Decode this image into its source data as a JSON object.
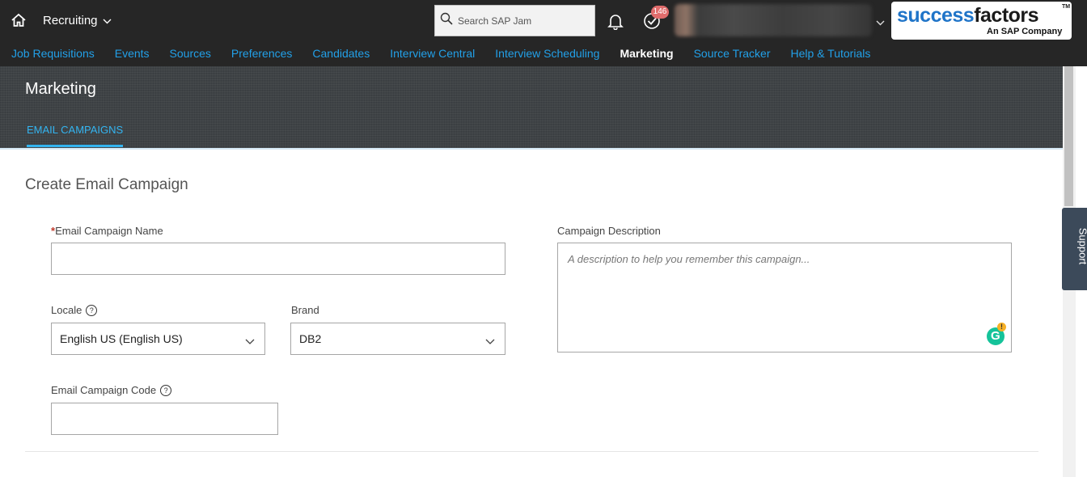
{
  "topbar": {
    "module": "Recruiting",
    "search_placeholder": "Search SAP Jam",
    "todo_count": "146",
    "logo_success": "success",
    "logo_factors": "factors",
    "logo_tm": "TM",
    "logo_tagline": "An SAP Company"
  },
  "nav": {
    "items": [
      {
        "label": "Job Requisitions"
      },
      {
        "label": "Events"
      },
      {
        "label": "Sources"
      },
      {
        "label": "Preferences"
      },
      {
        "label": "Candidates"
      },
      {
        "label": "Interview Central"
      },
      {
        "label": "Interview Scheduling"
      },
      {
        "label": "Marketing",
        "active": true
      },
      {
        "label": "Source Tracker"
      },
      {
        "label": "Help & Tutorials"
      }
    ]
  },
  "page": {
    "title": "Marketing",
    "tab": "EMAIL CAMPAIGNS"
  },
  "form": {
    "section_title": "Create Email Campaign",
    "required_mark": "*",
    "name_label": "Email Campaign Name",
    "name_value": "",
    "description_label": "Campaign Description",
    "description_placeholder": "A description to help you remember this campaign...",
    "locale_label": "Locale",
    "locale_value": "English US (English US)",
    "brand_label": "Brand",
    "brand_value": "DB2",
    "code_label": "Email Campaign Code",
    "code_value": ""
  },
  "support": {
    "label": "Support"
  },
  "colors": {
    "topbar_bg": "#262626",
    "nav_link": "#22a0e8",
    "header_bg": "#3f4346",
    "tab_accent": "#33b4f0",
    "badge": "#e06c6c",
    "required": "#c0392b"
  }
}
